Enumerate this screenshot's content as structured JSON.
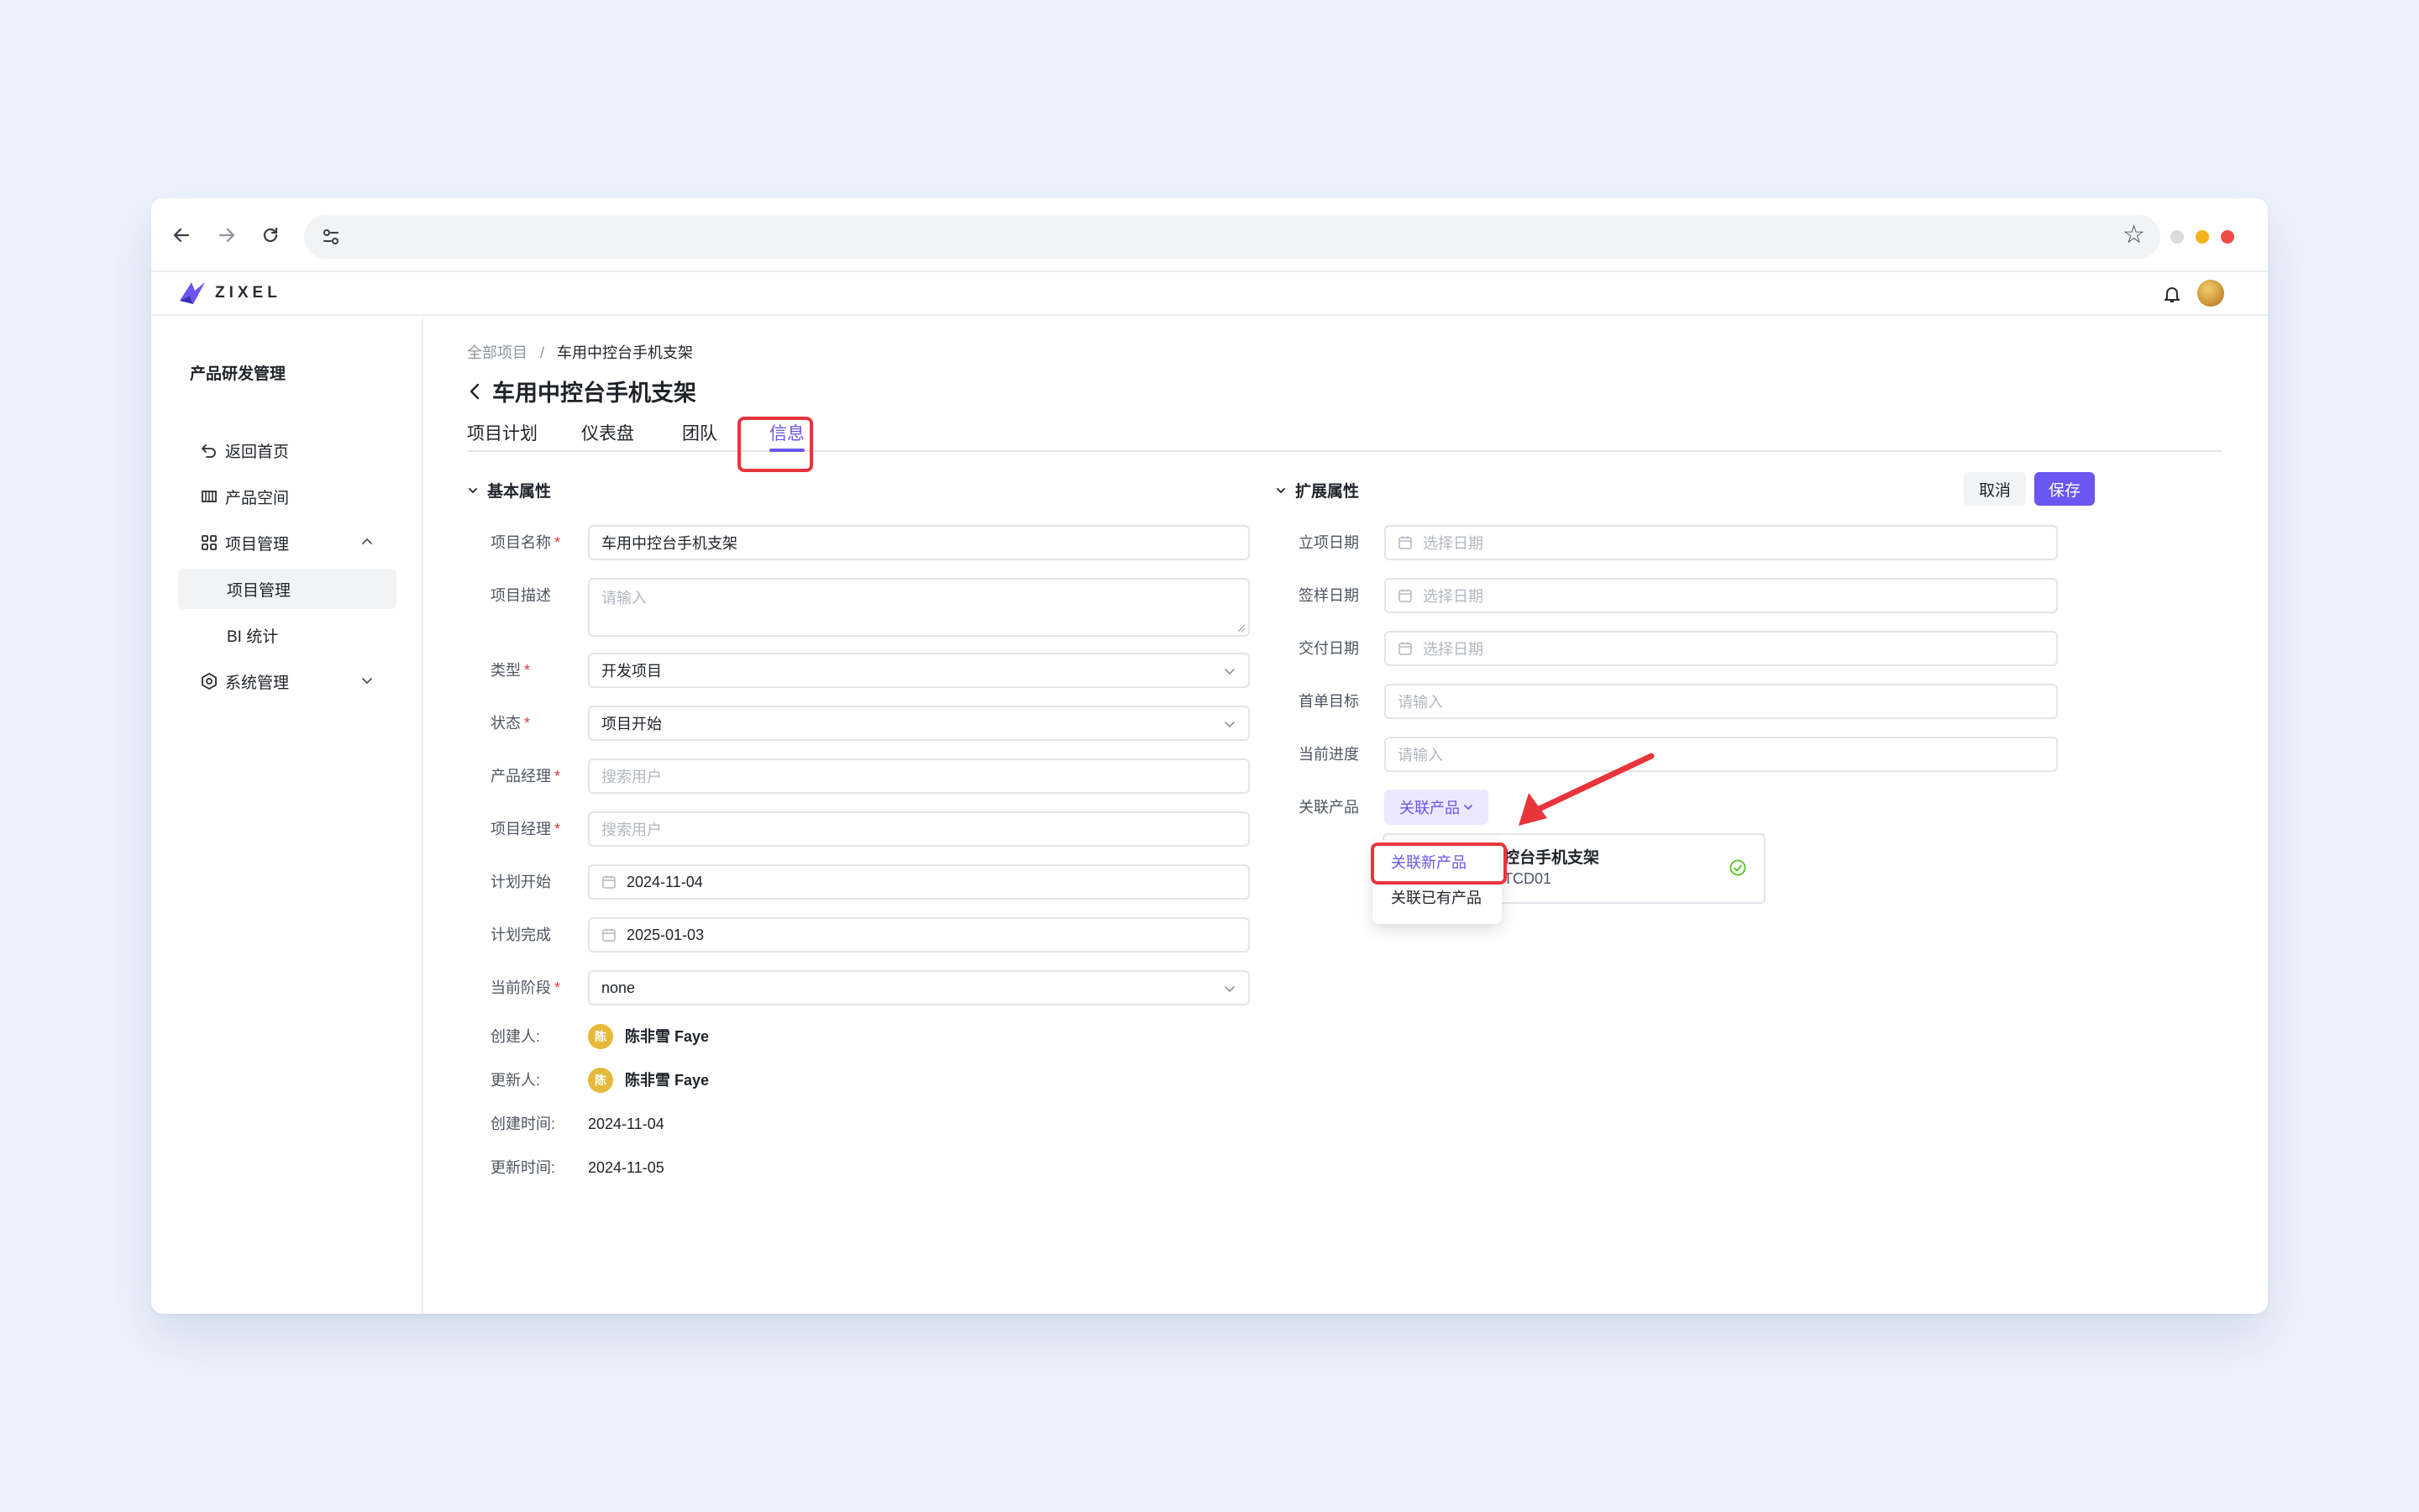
{
  "browser": {
    "window_dots": [
      "#d9dbdf",
      "#f5b21f",
      "#ee4b4b"
    ]
  },
  "app": {
    "logo_text": "ZIXEL",
    "accent": "#6a56f0",
    "highlight": "#e8343b"
  },
  "sidebar": {
    "title": "产品研发管理",
    "items": [
      {
        "label": "返回首页",
        "icon": "return-icon"
      },
      {
        "label": "产品空间",
        "icon": "product-space-icon"
      },
      {
        "label": "项目管理",
        "icon": "grid-icon"
      },
      {
        "label": "项目管理"
      },
      {
        "label": "BI 统计"
      },
      {
        "label": "系统管理",
        "icon": "settings-icon"
      }
    ]
  },
  "breadcrumb": {
    "root": "全部项目",
    "sep": "/",
    "current": "车用中控台手机支架"
  },
  "page": {
    "title": "车用中控台手机支架"
  },
  "tabs": [
    {
      "label": "项目计划"
    },
    {
      "label": "仪表盘"
    },
    {
      "label": "团队"
    },
    {
      "label": "信息",
      "active": true
    }
  ],
  "sections": {
    "basic": "基本属性",
    "extended": "扩展属性"
  },
  "actions": {
    "cancel": "取消",
    "save": "保存"
  },
  "basic_form": {
    "name_label": "项目名称",
    "name_value": "车用中控台手机支架",
    "desc_label": "项目描述",
    "desc_placeholder": "请输入",
    "type_label": "类型",
    "type_value": "开发项目",
    "status_label": "状态",
    "status_value": "项目开始",
    "pm_label": "产品经理",
    "pm_placeholder": "搜索用户",
    "proj_mgr_label": "项目经理",
    "proj_mgr_placeholder": "搜索用户",
    "start_label": "计划开始",
    "start_value": "2024-11-04",
    "end_label": "计划完成",
    "end_value": "2025-01-03",
    "stage_label": "当前阶段",
    "stage_value": "none",
    "creator_label": "创建人:",
    "creator_avatar": "陈",
    "creator_name": "陈非雪 Faye",
    "updater_label": "更新人:",
    "updater_avatar": "陈",
    "updater_name": "陈非雪 Faye",
    "created_label": "创建时间:",
    "created_value": "2024-11-04",
    "updated_label": "更新时间:",
    "updated_value": "2024-11-05",
    "required_mark": "*"
  },
  "ext_form": {
    "setup_label": "立项日期",
    "setup_placeholder": "选择日期",
    "sign_label": "签样日期",
    "sign_placeholder": "选择日期",
    "deliver_label": "交付日期",
    "deliver_placeholder": "选择日期",
    "first_target_label": "首单目标",
    "first_target_placeholder": "请输入",
    "progress_label": "当前进度",
    "progress_placeholder": "请输入",
    "related_label": "关联产品",
    "related_button": "关联产品"
  },
  "product_card": {
    "name_visible": "控台手机支架",
    "code_visible": "TCD01"
  },
  "dropdown_menu": {
    "items": [
      {
        "label": "关联新产品",
        "selected": true
      },
      {
        "label": "关联已有产品"
      }
    ]
  }
}
